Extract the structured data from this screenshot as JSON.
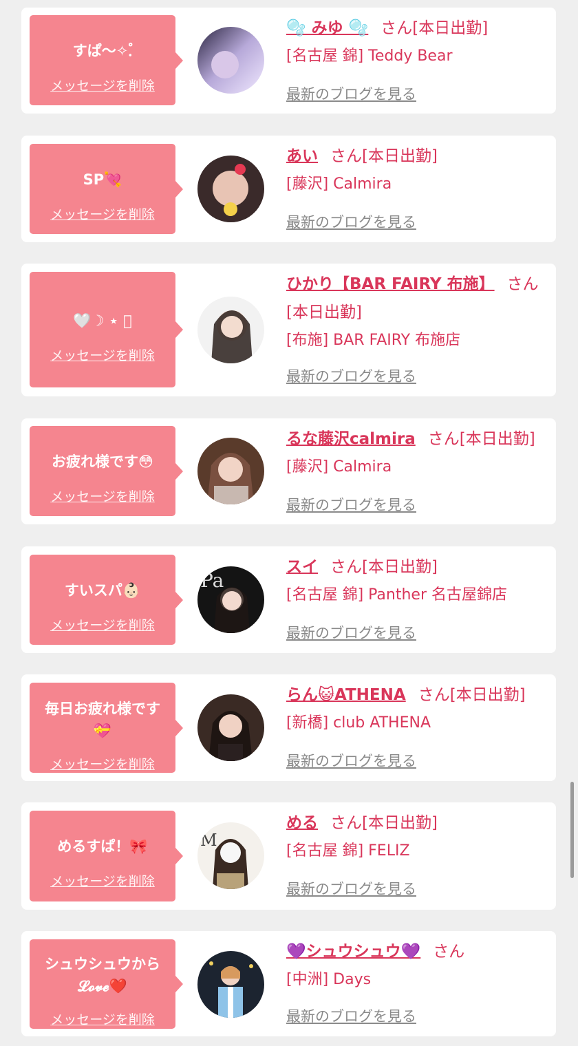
{
  "colors": {
    "bubble": "#f5858f",
    "accent": "#d9365a",
    "link_gray": "#8a8a8a",
    "background": "#efefef"
  },
  "delete_label": "メッセージを削除",
  "blog_label": "最新のブログを見る",
  "san_label": "さん",
  "attendance_label": "[本日出勤]",
  "items": [
    {
      "message": "すぱ〜✧.゚",
      "name": "🫧 みゆ 🫧",
      "suffix": "さん[本日出勤]",
      "shop": "[名古屋 錦] Teddy Bear",
      "avatar_icon": "girl-photo"
    },
    {
      "message": "SP💘",
      "name": "あい",
      "suffix": "さん[本日出勤]",
      "shop": "[藤沢] Calmira",
      "avatar_icon": "girl-photo"
    },
    {
      "message": "🤍☽ ⋆ ゚",
      "name": "ひかり【BAR FAIRY 布施】",
      "suffix": "さん[本日出勤]",
      "shop": "[布施] BAR FAIRY 布施店",
      "avatar_icon": "girl-photo"
    },
    {
      "message": "お疲れ様です😳",
      "name": "るな藤沢calmira",
      "suffix": "さん[本日出勤]",
      "shop": "[藤沢] Calmira",
      "avatar_icon": "girl-photo"
    },
    {
      "message": "すいスパ👶🏻",
      "name": "スイ",
      "suffix": "さん[本日出勤]",
      "shop": "[名古屋 錦] Panther 名古屋錦店",
      "avatar_icon": "girl-photo"
    },
    {
      "message": "毎日お疲れ様です\n💝",
      "name": "らん😺ATHENA",
      "suffix": "さん[本日出勤]",
      "shop": "[新橋] club ATHENA",
      "avatar_icon": "girl-photo"
    },
    {
      "message": "めるすぱ！🎀",
      "name": "める",
      "suffix": "さん[本日出勤]",
      "shop": "[名古屋 錦] FELIZ",
      "avatar_icon": "girl-photo"
    },
    {
      "message": "シュウシュウから\n𝓛𝓸𝓿𝓮❤️",
      "name": "💜シュウシュウ💜",
      "suffix": "さん",
      "shop": "[中洲] Days",
      "avatar_icon": "girl-photo"
    }
  ]
}
